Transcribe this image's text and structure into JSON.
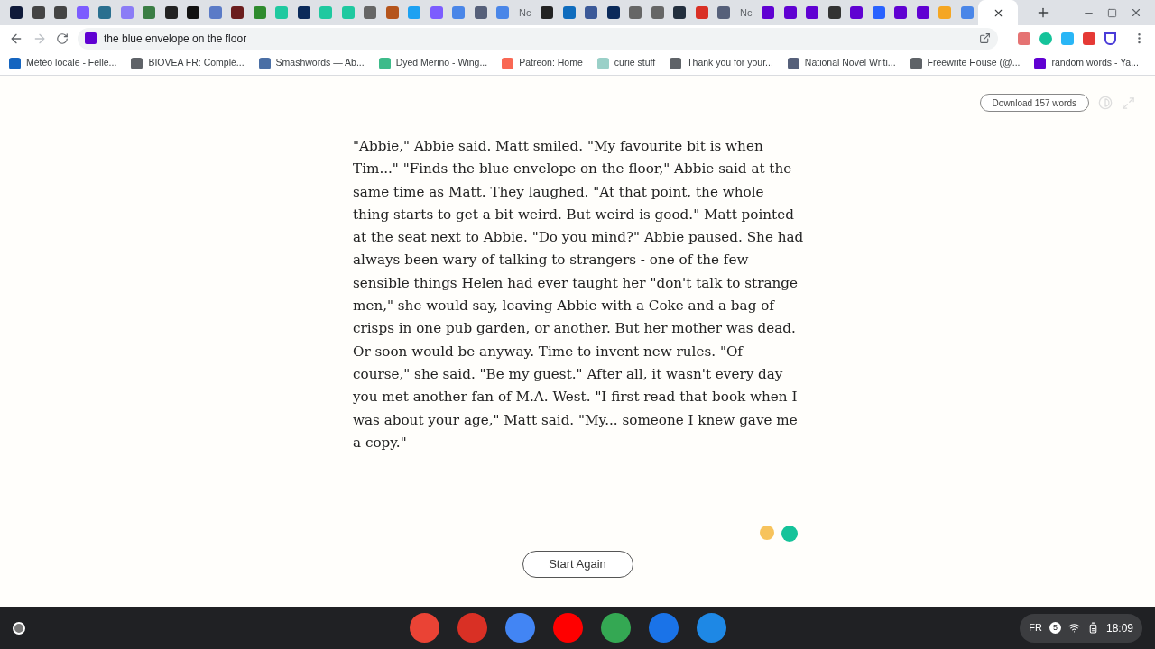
{
  "tabs": [
    {
      "kind": "icon",
      "color": "#0f1a3a",
      "selected": false
    },
    {
      "kind": "icon",
      "color": "#444444",
      "selected": false
    },
    {
      "kind": "icon",
      "color": "#444444",
      "selected": false
    },
    {
      "kind": "icon",
      "color": "#7c5cff",
      "selected": false
    },
    {
      "kind": "icon",
      "color": "#2a6f8f",
      "selected": false
    },
    {
      "kind": "icon",
      "color": "#8b7cf6",
      "selected": false
    },
    {
      "kind": "icon",
      "color": "#3a7d44",
      "selected": false
    },
    {
      "kind": "icon",
      "color": "#222222",
      "selected": false
    },
    {
      "kind": "icon",
      "color": "#111111",
      "selected": false
    },
    {
      "kind": "icon",
      "color": "#5b7bc7",
      "selected": false
    },
    {
      "kind": "icon",
      "color": "#6b1d1d",
      "selected": false
    },
    {
      "kind": "icon",
      "color": "#2e8b2e",
      "selected": false
    },
    {
      "kind": "icon",
      "color": "#1fc9a0",
      "selected": false
    },
    {
      "kind": "icon",
      "color": "#0b2a5a",
      "selected": false
    },
    {
      "kind": "icon",
      "color": "#1fc9a0",
      "selected": false
    },
    {
      "kind": "icon",
      "color": "#1fc9a0",
      "selected": false
    },
    {
      "kind": "icon",
      "color": "#666666",
      "selected": false
    },
    {
      "kind": "icon",
      "color": "#b5541c",
      "selected": false
    },
    {
      "kind": "icon",
      "color": "#1da1f2",
      "selected": false
    },
    {
      "kind": "icon",
      "color": "#7c5cff",
      "selected": false
    },
    {
      "kind": "icon",
      "color": "#4a86e8",
      "selected": false
    },
    {
      "kind": "icon",
      "color": "#56607a",
      "selected": false
    },
    {
      "kind": "icon",
      "color": "#4a86e8",
      "selected": false
    },
    {
      "kind": "text",
      "text": "Nc",
      "selected": false
    },
    {
      "kind": "icon",
      "color": "#222222",
      "selected": false
    },
    {
      "kind": "icon",
      "color": "#0f6cbd",
      "selected": false
    },
    {
      "kind": "icon",
      "color": "#3b5998",
      "selected": false
    },
    {
      "kind": "icon",
      "color": "#0b2a5a",
      "selected": false
    },
    {
      "kind": "icon",
      "color": "#666666",
      "selected": false
    },
    {
      "kind": "icon",
      "color": "#666666",
      "selected": false
    },
    {
      "kind": "icon",
      "color": "#232f3e",
      "selected": false
    },
    {
      "kind": "icon",
      "color": "#d93025",
      "selected": false
    },
    {
      "kind": "icon",
      "color": "#56607a",
      "selected": false
    },
    {
      "kind": "text",
      "text": "Nc",
      "selected": false
    },
    {
      "kind": "icon",
      "color": "#6001d2",
      "selected": false
    },
    {
      "kind": "icon",
      "color": "#6001d2",
      "selected": false
    },
    {
      "kind": "icon",
      "color": "#6001d2",
      "selected": false
    },
    {
      "kind": "icon",
      "color": "#333333",
      "selected": false
    },
    {
      "kind": "icon",
      "color": "#6001d2",
      "selected": false
    },
    {
      "kind": "icon",
      "color": "#2962ff",
      "selected": false
    },
    {
      "kind": "icon",
      "color": "#6001d2",
      "selected": false
    },
    {
      "kind": "icon",
      "color": "#6001d2",
      "selected": false
    },
    {
      "kind": "icon",
      "color": "#f5a623",
      "selected": false
    },
    {
      "kind": "icon",
      "color": "#4a86e8",
      "selected": false
    },
    {
      "kind": "blank",
      "selected": true
    }
  ],
  "address_bar": {
    "value": "the blue envelope on the floor"
  },
  "bookmarks": [
    {
      "label": "Météo locale - Felle...",
      "color": "#1565c0"
    },
    {
      "label": "BIOVEA FR: Complé...",
      "color": "#5f6368"
    },
    {
      "label": "Smashwords — Ab...",
      "color": "#4a6fa5"
    },
    {
      "label": "Dyed Merino - Wing...",
      "color": "#3dbb8a"
    },
    {
      "label": "Patreon: Home",
      "color": "#f96854"
    },
    {
      "label": "curie stuff",
      "color": "#9ad0c8"
    },
    {
      "label": "Thank you for your...",
      "color": "#5f6368"
    },
    {
      "label": "National Novel Writi...",
      "color": "#56607a"
    },
    {
      "label": "Freewrite House (@...",
      "color": "#5f6368"
    },
    {
      "label": "random words - Ya...",
      "color": "#6001d2"
    }
  ],
  "download_button": "Download 157 words",
  "story": "\"Abbie,\" Abbie said. Matt smiled. \"My favourite bit is when Tim...\" \"Finds the blue envelope on the floor,\" Abbie said at the same time as Matt. They laughed. \"At that point, the whole thing starts to get a bit weird. But weird is good.\" Matt pointed at the seat next to Abbie. \"Do you mind?\" Abbie paused. She had always been wary of talking to strangers - one of the few sensible things Helen had ever taught her \"don't talk to strange men,\" she would say, leaving Abbie with a Coke and a bag of crisps in one pub garden, or another. But her mother was dead. Or soon would be anyway. Time to invent new rules. \"Of course,\" she said. \"Be my guest.\" After all, it wasn't every day you met another fan of M.A. West. \"I first read that book when I was about your age,\" Matt said. \"My... someone I knew gave me a copy.\"",
  "start_again_button": "Start Again",
  "shelf": [
    {
      "color": "#ea4335"
    },
    {
      "color": "#d93025"
    },
    {
      "color": "#4285f4"
    },
    {
      "color": "#ff0000"
    },
    {
      "color": "#34a853"
    },
    {
      "color": "#1a73e8"
    },
    {
      "color": "#1e88e5"
    }
  ],
  "tray": {
    "language": "FR",
    "notifications": "5",
    "time": "18:09"
  }
}
